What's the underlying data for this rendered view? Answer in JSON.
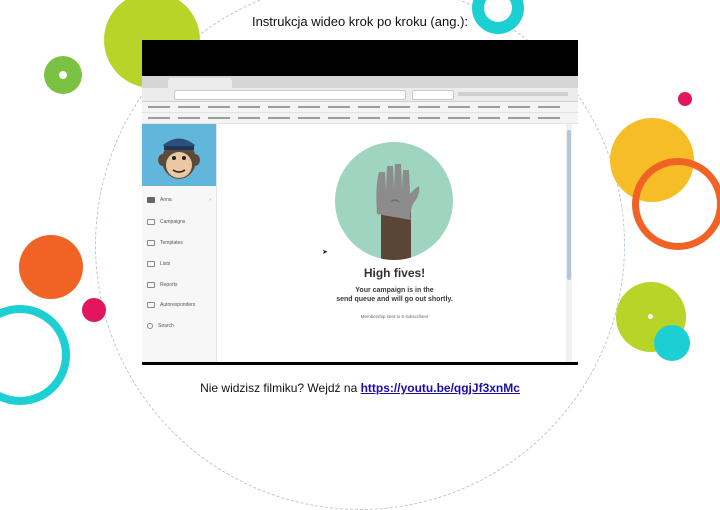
{
  "slide": {
    "title": "Instrukcja wideo krok po kroku (ang.):",
    "caption_text": "Nie widzisz filmiku? Wejdź na ",
    "caption_link": "https://youtu.be/qgjJf3xnMc"
  },
  "colors": {
    "lime": "#b9d428",
    "orange": "#f06324",
    "cyan": "#1ccfd3",
    "magenta": "#e3155c",
    "yellow": "#f6bd27",
    "green": "#7cc242",
    "teal_circle": "#9ed4c0"
  },
  "app": {
    "sidebar": {
      "items": [
        {
          "label": "Anna",
          "icon": "account-icon"
        },
        {
          "label": "Campaigns",
          "icon": "campaigns-icon"
        },
        {
          "label": "Templates",
          "icon": "templates-icon"
        },
        {
          "label": "Lists",
          "icon": "lists-icon"
        },
        {
          "label": "Reports",
          "icon": "reports-icon"
        },
        {
          "label": "Autoresponders",
          "icon": "autoresponders-icon"
        },
        {
          "label": "Search",
          "icon": "search-icon"
        }
      ]
    },
    "main": {
      "headline": "High fives!",
      "message_line1": "Your campaign is in the",
      "message_line2": "send queue and will go out shortly.",
      "membership": "Membership sent to 6 subscribers"
    }
  }
}
